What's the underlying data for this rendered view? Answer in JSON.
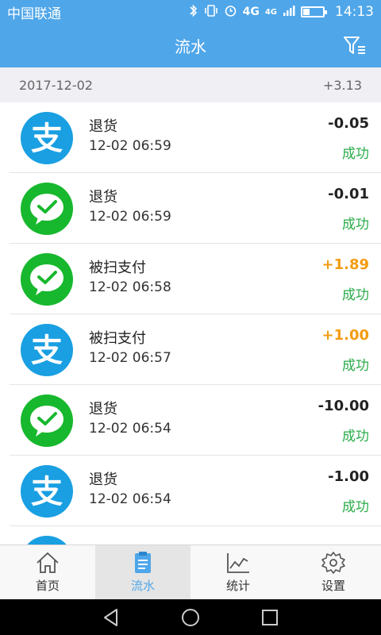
{
  "status_bar": {
    "carrier": "中国联通",
    "network": "4G",
    "network2": "4G",
    "time": "14:13"
  },
  "header": {
    "title": "流水"
  },
  "date_section": {
    "date": "2017-12-02",
    "total": "+3.13"
  },
  "transactions": [
    {
      "icon": "alipay-icon",
      "name": "退货",
      "time": "12-02 06:59",
      "amount": "-0.05",
      "status": "成功"
    },
    {
      "icon": "wechat-icon",
      "name": "退货",
      "time": "12-02 06:59",
      "amount": "-0.01",
      "status": "成功"
    },
    {
      "icon": "wechat-icon",
      "name": "被扫支付",
      "time": "12-02 06:58",
      "amount": "+1.89",
      "status": "成功"
    },
    {
      "icon": "alipay-icon",
      "name": "被扫支付",
      "time": "12-02 06:57",
      "amount": "+1.00",
      "status": "成功"
    },
    {
      "icon": "wechat-icon",
      "name": "退货",
      "time": "12-02 06:54",
      "amount": "-10.00",
      "status": "成功"
    },
    {
      "icon": "alipay-icon",
      "name": "退货",
      "time": "12-02 06:54",
      "amount": "-1.00",
      "status": "成功"
    }
  ],
  "tabs": [
    {
      "label": "首页",
      "icon": "home-icon"
    },
    {
      "label": "流水",
      "icon": "clipboard-icon"
    },
    {
      "label": "统计",
      "icon": "chart-icon"
    },
    {
      "label": "设置",
      "icon": "gear-icon"
    }
  ],
  "colors": {
    "primary": "#4fa6e9",
    "alipay": "#199fe2",
    "wechat": "#17b82d",
    "positive_amount": "#f39c12",
    "success": "#2aad4a"
  }
}
